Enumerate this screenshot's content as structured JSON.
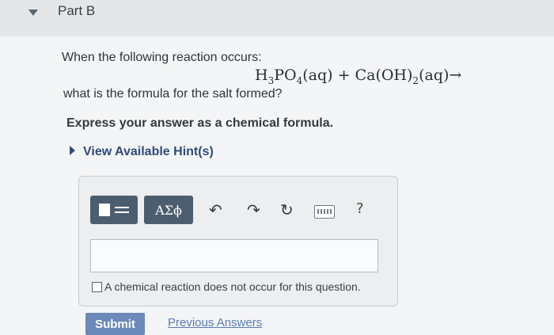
{
  "part": {
    "title": "Part B"
  },
  "question": {
    "intro": "When the following reaction occurs:",
    "equation": {
      "reactant1": {
        "base": "H",
        "sub1": "3",
        "mid": "PO",
        "sub2": "4",
        "state": "(aq)"
      },
      "plus": "+",
      "reactant2": {
        "base": "Ca(OH)",
        "sub": "2",
        "state": "(aq)"
      },
      "arrow": "→"
    },
    "prompt": "what is the formula for the salt formed?",
    "instruction": "Express your answer as a chemical formula."
  },
  "hint": {
    "label": "View Available Hint(s)"
  },
  "toolbar": {
    "symbols_label": "ΑΣϕ",
    "undo_icon": "↶",
    "redo_icon": "↷",
    "reset_icon": "↻",
    "help_label": "?"
  },
  "answer": {
    "value": ""
  },
  "checkbox": {
    "label": "A chemical reaction does not occur for this question."
  },
  "actions": {
    "submit_label": "Submit",
    "previous_label": "Previous Answers"
  }
}
